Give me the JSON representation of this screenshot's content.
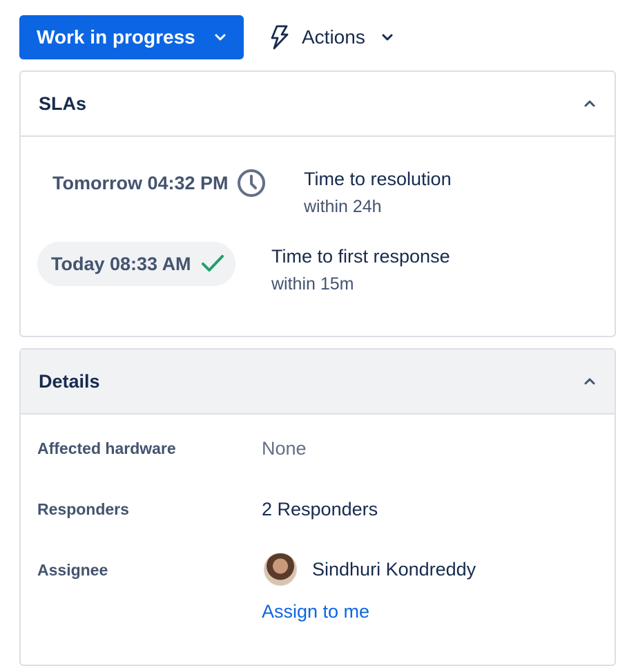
{
  "toolbar": {
    "status_label": "Work in progress",
    "actions_label": "Actions"
  },
  "sla": {
    "title": "SLAs",
    "items": [
      {
        "time": "Tomorrow 04:32 PM",
        "name": "Time to resolution",
        "goal": "within 24h",
        "state": "running"
      },
      {
        "time": "Today 08:33 AM",
        "name": "Time to first response",
        "goal": "within 15m",
        "state": "met"
      }
    ]
  },
  "details": {
    "title": "Details",
    "fields": {
      "affected_hardware": {
        "label": "Affected hardware",
        "value": "None"
      },
      "responders": {
        "label": "Responders",
        "value": "2 Responders"
      },
      "assignee": {
        "label": "Assignee",
        "value": "Sindhuri Kondreddy",
        "action": "Assign to me"
      }
    }
  },
  "colors": {
    "primary": "#0c66e4",
    "text": "#172b4d",
    "subtle": "#44546f",
    "success": "#22a06b",
    "border": "#dcdfe4"
  }
}
